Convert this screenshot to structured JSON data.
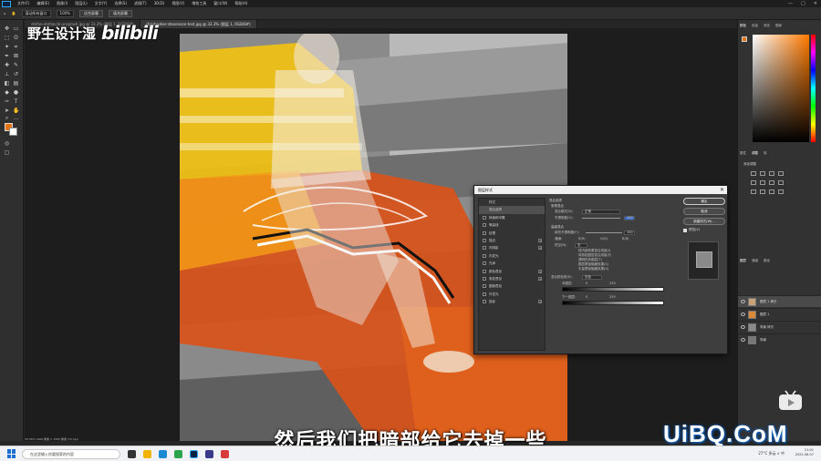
{
  "menubar": {
    "items": [
      "文件(F)",
      "编辑(E)",
      "图像(I)",
      "图层(L)",
      "文字(Y)",
      "选择(S)",
      "滤镜(T)",
      "3D(D)",
      "视图(V)",
      "增效工具",
      "窗口(W)",
      "帮助(H)"
    ]
  },
  "options_bar": {
    "scroll_all": "滚动所有窗口",
    "zoom": "100%",
    "fit_screen": "适合屏幕",
    "fill_screen": "填充屏幕"
  },
  "tabs": [
    {
      "label": "stefan-stefancik-unsplash.jpg @ 33.3% (图层 1, RGB/8#)",
      "active": false
    },
    {
      "label": "christopher-stevenson-test.jpg @ 33.3% (图层 1, RGB/8#)",
      "active": true
    }
  ],
  "watermark": {
    "name": "野生设计湿",
    "logo": "bilibili"
  },
  "dialog": {
    "title": "图层样式",
    "close": "✕",
    "styles": [
      {
        "label": "样式",
        "checkbox": false,
        "plus": false
      },
      {
        "label": "混合选项",
        "checkbox": false,
        "plus": false,
        "selected": true
      },
      {
        "label": "斜面和浮雕",
        "checkbox": true,
        "plus": false
      },
      {
        "label": "等高线",
        "checkbox": true,
        "plus": false
      },
      {
        "label": "纹理",
        "checkbox": true,
        "plus": false
      },
      {
        "label": "描边",
        "checkbox": true,
        "plus": true
      },
      {
        "label": "内阴影",
        "checkbox": true,
        "plus": true
      },
      {
        "label": "内发光",
        "checkbox": true,
        "plus": false
      },
      {
        "label": "光泽",
        "checkbox": true,
        "plus": false
      },
      {
        "label": "颜色叠加",
        "checkbox": true,
        "plus": true
      },
      {
        "label": "渐变叠加",
        "checkbox": true,
        "plus": true
      },
      {
        "label": "图案叠加",
        "checkbox": true,
        "plus": false
      },
      {
        "label": "外发光",
        "checkbox": true,
        "plus": false
      },
      {
        "label": "投影",
        "checkbox": true,
        "plus": true
      }
    ],
    "blend": {
      "section1": "混合选项",
      "general": "常规混合",
      "mode_label": "混合模式(D):",
      "mode_value": "正常",
      "opacity_label": "不透明度(O):",
      "opacity_value": "100",
      "advanced": "高级混合",
      "fill_label": "填充不透明度(F):",
      "fill_value": "100",
      "channels_label": "通道:",
      "channels": [
        "R(R)",
        "G(G)",
        "B(B)"
      ],
      "knockout_label": "挖空(N):",
      "knockout_value": "无",
      "opts": [
        "将内部效果混合成组(I)",
        "将剪贴图层混合成组(P)",
        "透明形状图层(T)",
        "图层蒙版隐藏效果(S)",
        "矢量蒙版隐藏效果(H)"
      ],
      "blend_if_label": "混合颜色带(E):",
      "blend_if_value": "灰色",
      "this_layer": "本图层:",
      "this_min": "0",
      "this_max": "255",
      "under_layer": "下一图层:",
      "under_min": "0",
      "under_max": "255"
    },
    "buttons": {
      "ok": "确定",
      "cancel": "取消",
      "new_style": "新建样式(W)...",
      "preview": "预览(V)"
    }
  },
  "right_panel": {
    "tabs1": [
      "颜色",
      "色板",
      "渐变",
      "图案"
    ],
    "tabs2": [
      "属性",
      "调整",
      "库"
    ],
    "adjust_label": "添加调整",
    "tabs3": [
      "图层",
      "通道",
      "路径"
    ],
    "layers": [
      {
        "name": "图层 1 拷贝",
        "selected": true,
        "thumb": "#c9a27a"
      },
      {
        "name": "图层 1",
        "selected": false,
        "thumb": "#d98b3a"
      },
      {
        "name": "背景 拷贝",
        "selected": false,
        "thumb": "#8a8a8a"
      },
      {
        "name": "背景",
        "selected": false,
        "thumb": "#777"
      }
    ]
  },
  "statusbar": "33.33%   1400 像素 × 1500 像素 (72 ppi)",
  "subtitle": "然后我们把暗部给它去掉一些",
  "site_mark": "UiBQ.CoM",
  "taskbar": {
    "search_placeholder": "在这里输入你要搜索的内容",
    "tray": "27°C 多云  ∧  中",
    "time": "21:01",
    "date": "2022-06-07"
  },
  "colors": {
    "accent": "#e8730f",
    "ps_blue": "#31a8ff",
    "canvas_orange": "#d9531a",
    "canvas_yellow": "#f2c20f"
  }
}
